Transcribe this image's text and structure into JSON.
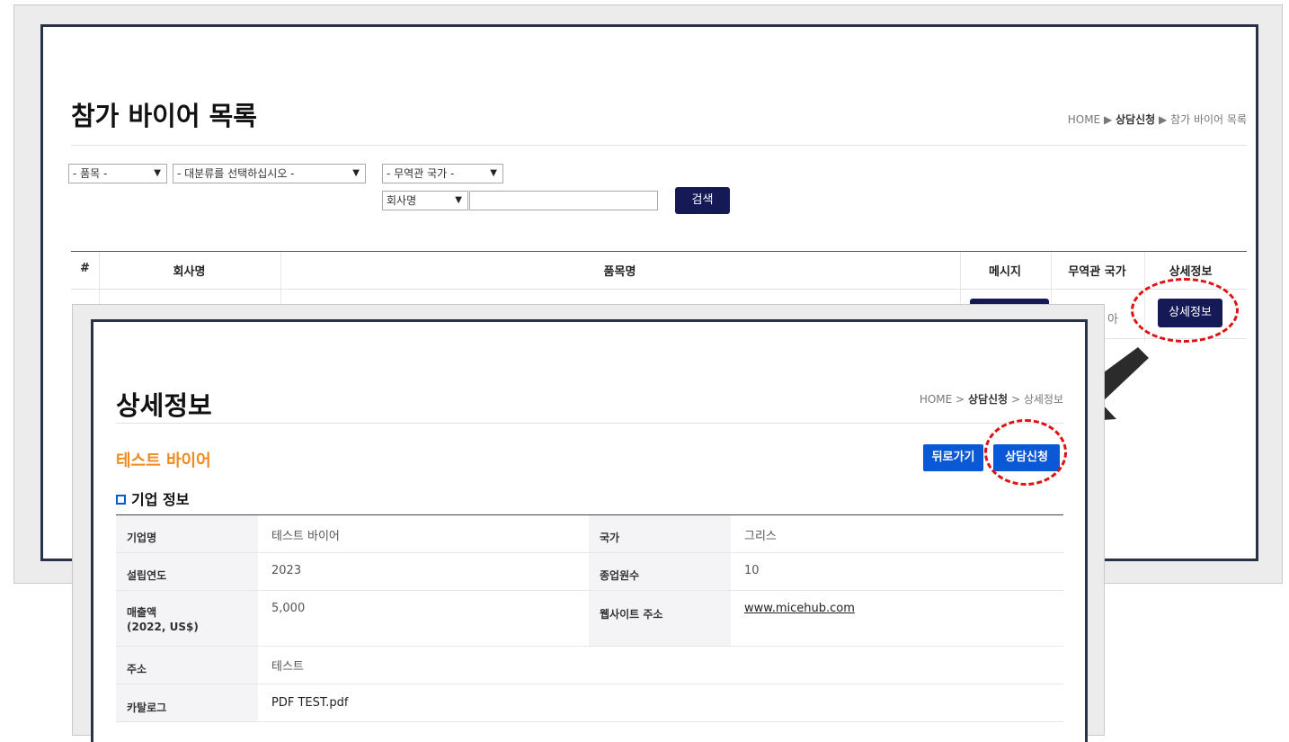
{
  "list_page": {
    "title": "참가 바이어 목록",
    "breadcrumb": {
      "home": "HOME",
      "sep": "▶",
      "parent": "상담신청",
      "current": "참가 바이어 목록"
    },
    "filters": {
      "item": "- 품목 -",
      "category": "- 대분류를 선택하십시오 -",
      "country": "- 무역관 국가 -",
      "field": "회사명",
      "keyword": "",
      "search_label": "검색"
    },
    "table": {
      "headers": [
        "#",
        "회사명",
        "품목명",
        "메시지",
        "무역관 국가",
        "상세정보"
      ],
      "row_partial_country": "아",
      "detail_label": "상세정보"
    }
  },
  "detail_page": {
    "title": "상세정보",
    "breadcrumb": {
      "home": "HOME",
      "sep": ">",
      "parent": "상담신청",
      "current": "상세정보"
    },
    "company_name": "테스트 바이어",
    "back_label": "뒤로가기",
    "apply_label": "상담신청",
    "section_title": "기업 정보",
    "rows": [
      {
        "label": "기업명",
        "value": "테스트 바이어",
        "label2": "국가",
        "value2": "그리스"
      },
      {
        "label": "설립연도",
        "value": "2023",
        "label2": "종업원수",
        "value2": "10"
      },
      {
        "label": "매출액",
        "label_sub": "(2022, US$)",
        "value": "5,000",
        "label2": "웹사이트 주소",
        "value2": "www.micehub.com"
      },
      {
        "label": "주소",
        "value": "테스트"
      },
      {
        "label": "카탈로그",
        "value": "PDF TEST.pdf"
      }
    ]
  },
  "colors": {
    "navy": "#151a56",
    "blue": "#0b58d6",
    "orange": "#f08a1c",
    "annotation_red": "#e01010",
    "frame_border": "#2a3247"
  },
  "icons": [
    "chevron-down-icon",
    "arrow-down-left-icon",
    "square-bullet-icon"
  ]
}
